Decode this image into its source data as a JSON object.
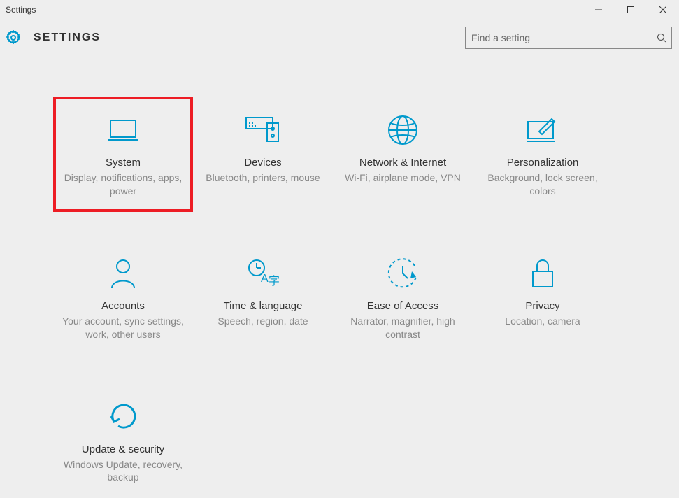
{
  "window": {
    "title": "Settings"
  },
  "header": {
    "title": "SETTINGS",
    "search_placeholder": "Find a setting"
  },
  "accent": "#0099cc",
  "tiles": [
    {
      "title": "System",
      "desc": "Display, notifications, apps, power"
    },
    {
      "title": "Devices",
      "desc": "Bluetooth, printers, mouse"
    },
    {
      "title": "Network & Internet",
      "desc": "Wi-Fi, airplane mode, VPN"
    },
    {
      "title": "Personalization",
      "desc": "Background, lock screen, colors"
    },
    {
      "title": "Accounts",
      "desc": "Your account, sync settings, work, other users"
    },
    {
      "title": "Time & language",
      "desc": "Speech, region, date"
    },
    {
      "title": "Ease of Access",
      "desc": "Narrator, magnifier, high contrast"
    },
    {
      "title": "Privacy",
      "desc": "Location, camera"
    },
    {
      "title": "Update & security",
      "desc": "Windows Update, recovery, backup"
    }
  ]
}
